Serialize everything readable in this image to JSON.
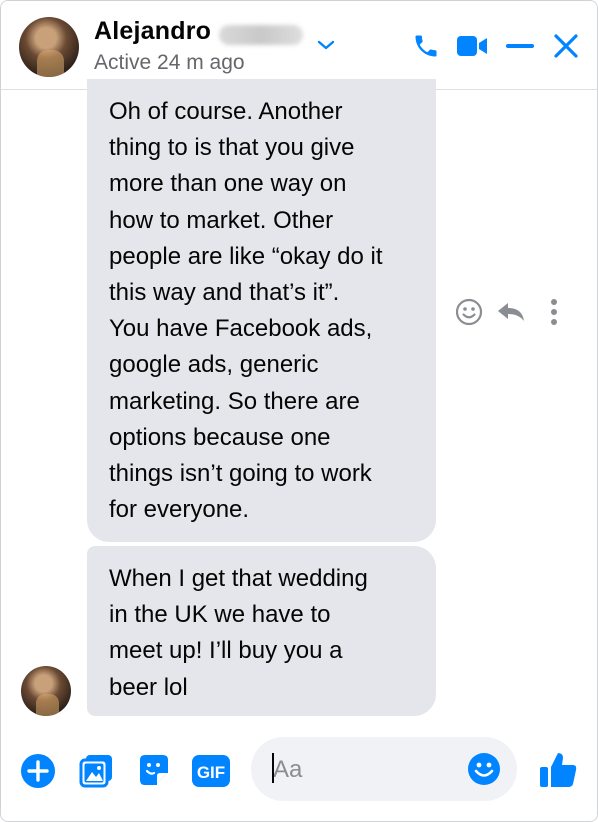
{
  "header": {
    "name": "Alejandro",
    "status": "Active 24 m ago"
  },
  "messages": [
    {
      "sender": "Alejandro",
      "text": "Oh of course. Another\nthing to is that you give\nmore than one way on\nhow to market. Other\npeople are like “okay do it\nthis way and that’s it”.\nYou have Facebook ads,\ngoogle ads, generic\nmarketing. So there are\noptions because one\nthings isn’t going to work\nfor everyone."
    },
    {
      "sender": "Alejandro",
      "text": "When I get that wedding\nin the UK we have to\nmeet up! I’ll buy you a\nbeer lol"
    }
  ],
  "composer": {
    "placeholder": "Aa",
    "gif_label": "GIF"
  },
  "colors": {
    "accent": "#0084ff",
    "bubble": "#e4e6eb",
    "muted": "#65676b",
    "icon_gray": "#8a8d91"
  },
  "icons": [
    "chevron-down-icon",
    "phone-icon",
    "video-icon",
    "minimize-icon",
    "close-icon",
    "smiley-icon",
    "reply-icon",
    "more-icon",
    "plus-icon",
    "image-icon",
    "sticker-icon",
    "gif-icon",
    "emoji-icon",
    "like-icon"
  ]
}
